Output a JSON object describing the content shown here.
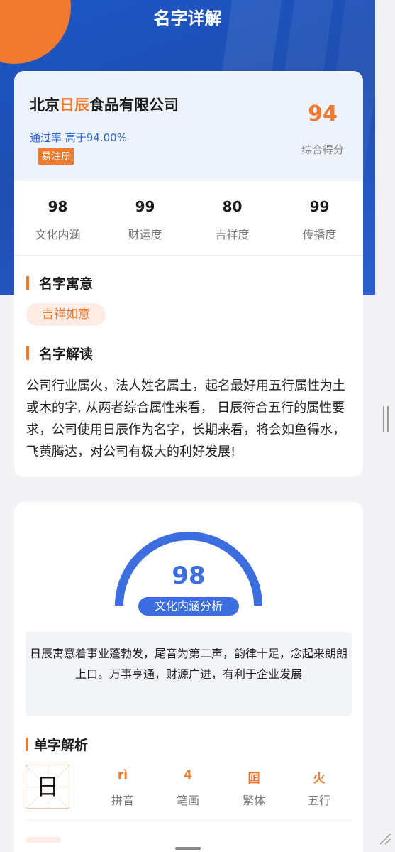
{
  "header": {
    "title": "名字详解"
  },
  "company": {
    "name_prefix": "北京",
    "name_highlight": "日辰",
    "name_suffix": "食品有限公司",
    "pass_rate": "通过率  高于94.00%",
    "badge": "易注册",
    "score": "94",
    "score_label": "综合得分"
  },
  "metrics": [
    {
      "value": "98",
      "label": "文化内涵"
    },
    {
      "value": "99",
      "label": "财运度"
    },
    {
      "value": "80",
      "label": "吉祥度"
    },
    {
      "value": "99",
      "label": "传播度"
    }
  ],
  "meaning": {
    "title": "名字寓意",
    "tag": "吉祥如意"
  },
  "interpretation": {
    "title": "名字解读",
    "text": "公司行业属火，法人姓名属土，起名最好用五行属性为土或木的字, 从两者综合属性来看， 日辰符合五行的属性要求，公司使用日辰作为名字，长期来看，将会如鱼得水，飞黄腾达，对公司有极大的利好发展!"
  },
  "culture": {
    "score": "98",
    "score_fraction": 0.98,
    "label": "文化内涵分析",
    "description": "日辰寓意着事业蓬勃发，尾音为第二声，韵律十足，念起来朗朗上口。万事亨通，财源广进，有利于企业发展",
    "gauge_color": "#3d6ee0"
  },
  "char_analysis": {
    "title": "单字解析",
    "char": "日",
    "items": [
      {
        "value": "rì",
        "label": "拼音"
      },
      {
        "value": "4",
        "label": "笔画"
      },
      {
        "value": "囸",
        "label": "繁体"
      },
      {
        "value": "火",
        "label": "五行"
      }
    ]
  },
  "colors": {
    "accent": "#ef7a2f",
    "primary": "#3d6ee0",
    "hero": "#1f4eb0"
  }
}
